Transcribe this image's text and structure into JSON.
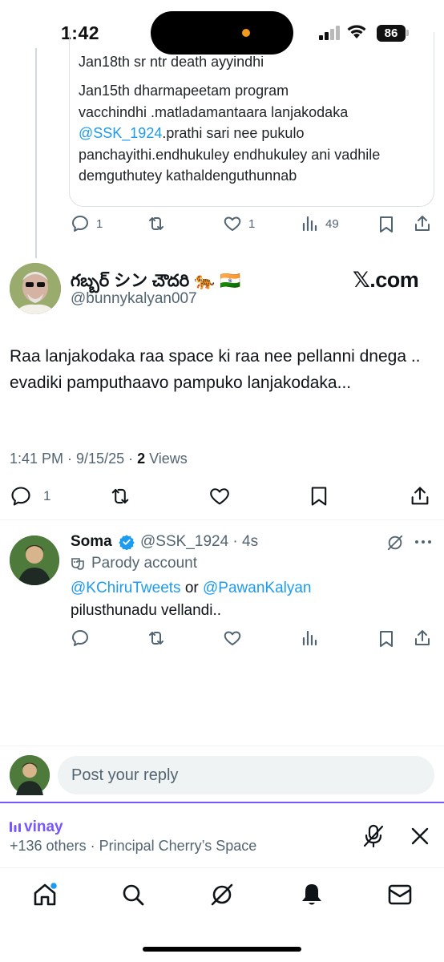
{
  "status_bar": {
    "time": "1:42",
    "battery": "86"
  },
  "quoted_tweet": {
    "text_lines": [
      "Jan18th sr ntr death ayyindhi",
      "Jan15th dharmapeetam program",
      "vacchindhi .matladamantaara lanjakodaka"
    ],
    "mention": "@SSK_1924",
    "text_after_mention": ".prathi sari nee pukulo panchayithi.endhukuley endhukuley ani vadhile demguthutey kathaldenguthunnab",
    "stats": {
      "replies": "1",
      "likes": "1",
      "views": "49"
    }
  },
  "main_tweet": {
    "author_name": "గబ్బర్ シン చౌదరి 🐅 🇮🇳",
    "author_handle": "@bunnykalyan007",
    "source_badge": "𝕏.com",
    "body": "Raa lanjakodaka raa space ki raa nee pellanni dnega .. evadiki pamputhaavo pampuko lanjakodaka...",
    "timestamp": "1:41 PM · 9/15/25 · ",
    "views_count": "2",
    "views_label": " Views",
    "stats": {
      "replies": "1"
    }
  },
  "reply": {
    "author_name": "Soma",
    "author_handle": "@SSK_1924 · 4s",
    "parody_label": "Parody account",
    "mention_1": "@KChiruTweets",
    "connector": " or ",
    "mention_2": "@PawanKalyan",
    "text": "pilusthunadu vellandi.."
  },
  "composer": {
    "placeholder": "Post your reply"
  },
  "space": {
    "host": "vinay",
    "subtitle": "+136 others · Principal Cherry’s Space"
  },
  "colors": {
    "link": "#1d9bf0",
    "space_accent": "#7856ff",
    "secondary_text": "#536471",
    "verified": "#1d9bf0"
  },
  "icons": {
    "nav": [
      "home-icon",
      "search-icon",
      "grok-icon",
      "notifications-icon",
      "messages-icon"
    ]
  }
}
